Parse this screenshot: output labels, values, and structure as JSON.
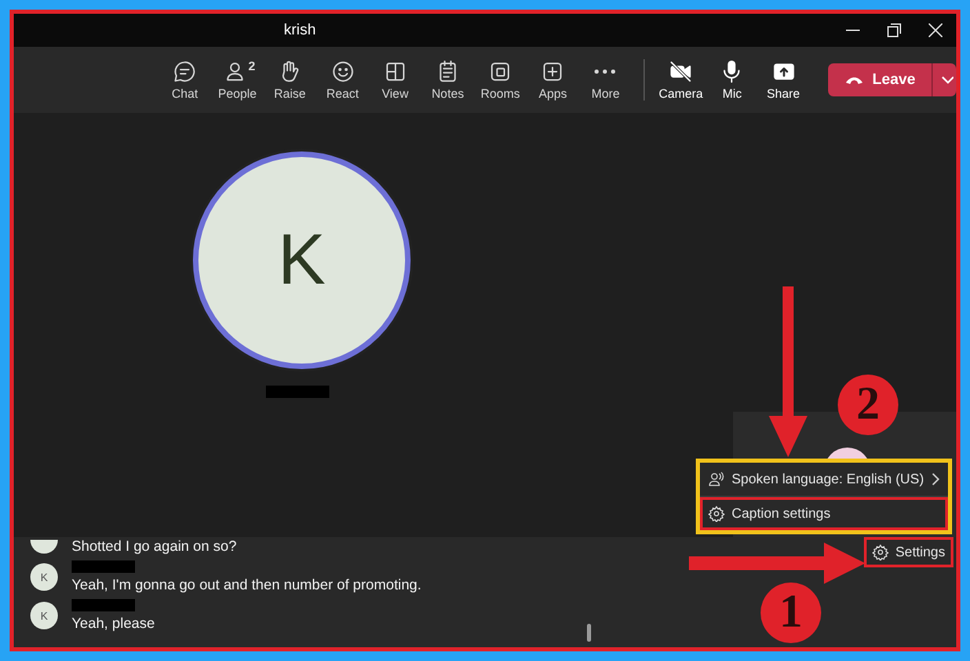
{
  "window": {
    "title": "krish"
  },
  "toolbar": [
    {
      "label": "Chat"
    },
    {
      "label": "People",
      "badge": "2"
    },
    {
      "label": "Raise"
    },
    {
      "label": "React"
    },
    {
      "label": "View"
    },
    {
      "label": "Notes"
    },
    {
      "label": "Rooms"
    },
    {
      "label": "Apps"
    },
    {
      "label": "More"
    }
  ],
  "media_controls": [
    {
      "label": "Camera"
    },
    {
      "label": "Mic"
    },
    {
      "label": "Share"
    }
  ],
  "leave_button": {
    "label": "Leave"
  },
  "stage": {
    "avatar": {
      "initial": "K"
    }
  },
  "menu": {
    "annotated": true,
    "items": [
      {
        "label": "Spoken language: English (US)",
        "submenu": true,
        "annotated": false
      },
      {
        "label": "Caption settings",
        "submenu": false,
        "annotated": true
      }
    ]
  },
  "captions": [
    {
      "text": "Shotted I go again on so?"
    },
    {
      "initial": "K",
      "text": "Yeah, I'm gonna go out and then number of promoting."
    },
    {
      "initial": "K",
      "text": "Yeah, please"
    }
  ],
  "settings_button": {
    "label": "Settings",
    "annotated": true
  },
  "annotations": [
    {
      "number": "1"
    },
    {
      "number": "2"
    }
  ]
}
